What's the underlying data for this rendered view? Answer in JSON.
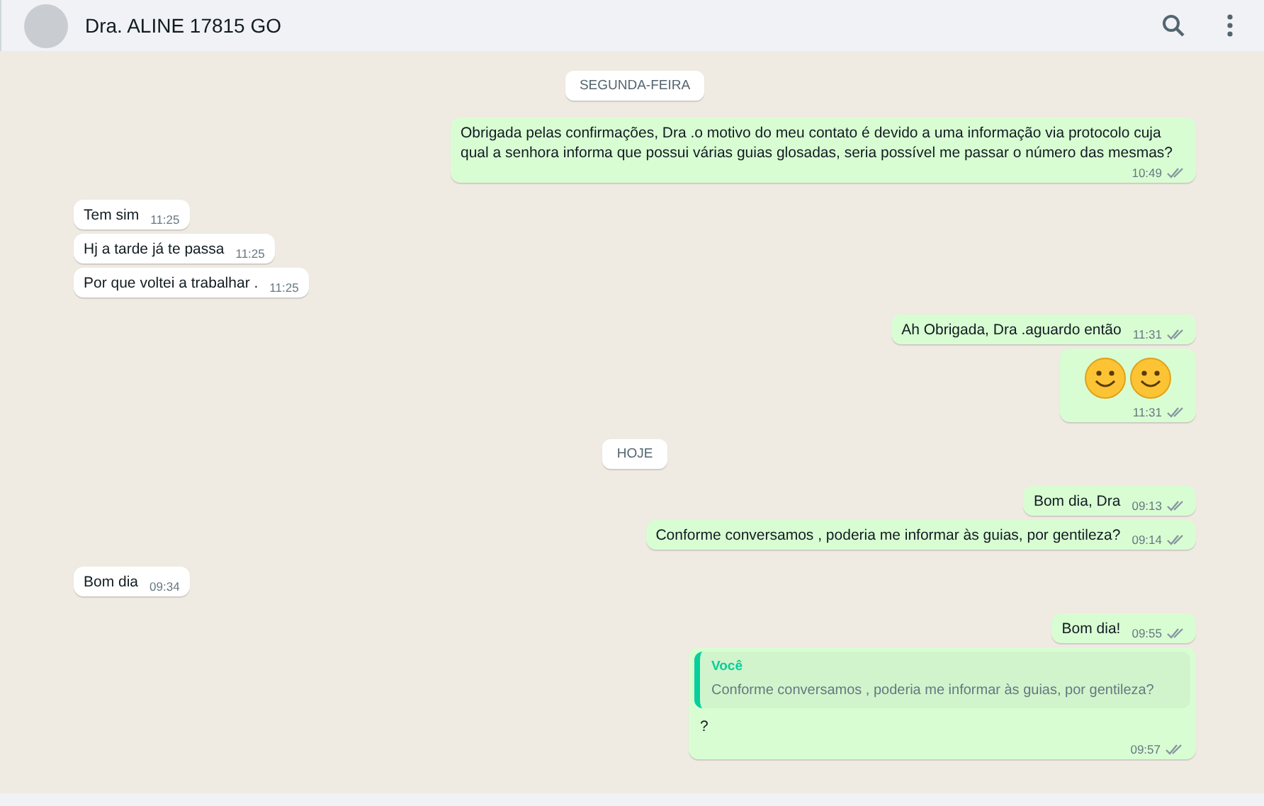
{
  "header": {
    "contact_name": "Dra. ALINE 17815 GO"
  },
  "messages": [
    {
      "kind": "date",
      "text": "SEGUNDA-FEIRA"
    },
    {
      "kind": "out",
      "text": "Obrigada pelas confirmações, Dra .o motivo do meu contato é devido a uma informação via protocolo cuja qual a senhora informa que possui várias guias glosadas, seria possível me passar o número das mesmas?",
      "time": "10:49",
      "delivered": true
    },
    {
      "kind": "in",
      "text": "Tem sim",
      "time": "11:25"
    },
    {
      "kind": "in",
      "text": "Hj a tarde já te passa",
      "time": "11:25"
    },
    {
      "kind": "in",
      "text": "Por que voltei a trabalhar .",
      "time": "11:25"
    },
    {
      "kind": "out",
      "text": "Ah Obrigada, Dra .aguardo então",
      "time": "11:31",
      "delivered": true
    },
    {
      "kind": "emoji",
      "emojis": [
        {
          "kind": "smiley"
        },
        {
          "kind": "smiley"
        }
      ],
      "time": "11:31",
      "delivered": true
    },
    {
      "kind": "date",
      "text": "HOJE"
    },
    {
      "kind": "out",
      "text": "Bom dia, Dra",
      "time": "09:13",
      "delivered": true
    },
    {
      "kind": "out",
      "text": "Conforme conversamos , poderia me informar às guias, por gentileza?",
      "time": "09:14",
      "delivered": true
    },
    {
      "kind": "in",
      "text": "Bom dia",
      "time": "09:34"
    },
    {
      "kind": "out",
      "text": "Bom dia!",
      "time": "09:55",
      "delivered": true
    },
    {
      "kind": "quote",
      "quote_author": "Você",
      "quote_text": "Conforme conversamos , poderia me informar às guias, por gentileza?",
      "text": "?",
      "time": "09:57",
      "delivered": true
    }
  ]
}
